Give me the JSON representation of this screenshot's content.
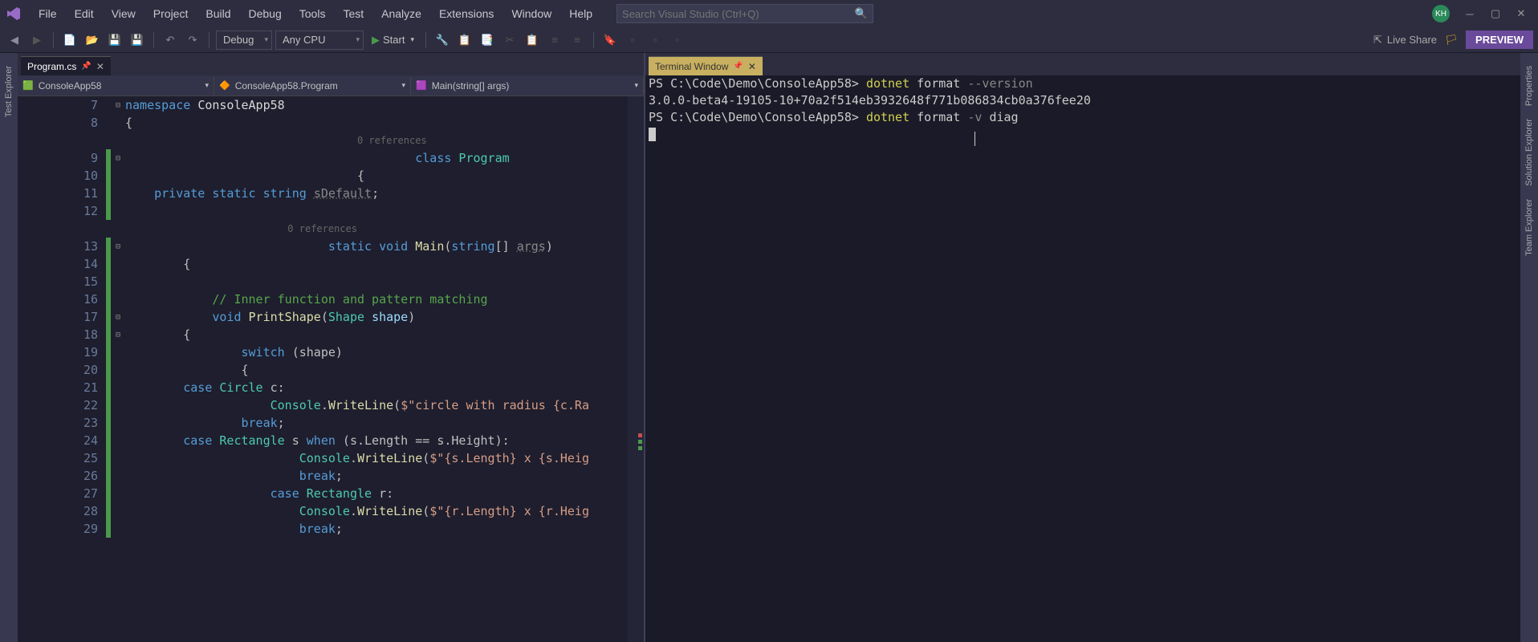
{
  "menu": [
    "File",
    "Edit",
    "View",
    "Project",
    "Build",
    "Debug",
    "Tools",
    "Test",
    "Analyze",
    "Extensions",
    "Window",
    "Help"
  ],
  "search": {
    "placeholder": "Search Visual Studio (Ctrl+Q)"
  },
  "avatar": "KH",
  "toolbar": {
    "config": "Debug",
    "platform": "Any CPU",
    "start": "Start",
    "liveShare": "Live Share",
    "preview": "PREVIEW"
  },
  "leftRail": [
    "Test Explorer"
  ],
  "rightRail": [
    "Properties",
    "Solution Explorer",
    "Team Explorer"
  ],
  "editorTab": {
    "name": "Program.cs"
  },
  "nav": {
    "project": "ConsoleApp58",
    "class": "ConsoleApp58.Program",
    "member": "Main(string[] args)"
  },
  "code": {
    "lines": [
      {
        "n": 7,
        "fold": "-",
        "html": "<span class='kw'>namespace</span> <span class='ident'>ConsoleApp58</span>"
      },
      {
        "n": 8,
        "html": "{"
      },
      {
        "hint": "                                        0 references"
      },
      {
        "n": 9,
        "fold": "-",
        "cb": "green",
        "html": "                                        <span class='kw'>class</span> <span class='type'>Program</span>"
      },
      {
        "n": 10,
        "cb": "green",
        "html": "                                {"
      },
      {
        "n": 11,
        "cb": "green",
        "html": "    <span class='kw'>private</span> <span class='kw'>static</span> <span class='kw'>string</span> <span class='dim'>sDefault</span>;"
      },
      {
        "n": 12,
        "cb": "green",
        "html": ""
      },
      {
        "hint": "                            0 references"
      },
      {
        "n": 13,
        "fold": "-",
        "cb": "green",
        "html": "                            <span class='kw'>static</span> <span class='kw'>void</span> <span class='fn'>Main</span>(<span class='kw'>string</span>[] <span class='param dim'>args</span>)"
      },
      {
        "n": 14,
        "cb": "green",
        "html": "        {"
      },
      {
        "n": 15,
        "cb": "green",
        "html": ""
      },
      {
        "n": 16,
        "cb": "green",
        "html": "            <span class='com'>// Inner function and pattern matching</span>"
      },
      {
        "n": 17,
        "fold": "-",
        "cb": "green",
        "html": "            <span class='kw'>void</span> <span class='fn'>PrintShape</span>(<span class='type'>Shape</span> <span class='param'>shape</span>)"
      },
      {
        "n": 18,
        "fold": "-",
        "cb": "green",
        "html": "        {"
      },
      {
        "n": 19,
        "cb": "green",
        "html": "                <span class='kw'>switch</span> (shape)"
      },
      {
        "n": 20,
        "cb": "green",
        "html": "                {"
      },
      {
        "n": 21,
        "cb": "green",
        "html": "        <span class='kw'>case</span> <span class='type'>Circle</span> c:"
      },
      {
        "n": 22,
        "cb": "green",
        "html": "                    <span class='type'>Console</span>.<span class='fn'>WriteLine</span>(<span class='str'>$\"circle with radius {c.Ra</span>"
      },
      {
        "n": 23,
        "cb": "green",
        "html": "                <span class='kw'>break</span>;"
      },
      {
        "n": 24,
        "cb": "green",
        "html": "        <span class='kw'>case</span> <span class='type'>Rectangle</span> s <span class='kw'>when</span> (s.Length == s.Height):"
      },
      {
        "n": 25,
        "cb": "green",
        "html": "                        <span class='type'>Console</span>.<span class='fn'>WriteLine</span>(<span class='str'>$\"{s.Length} x {s.Heig</span>"
      },
      {
        "n": 26,
        "cb": "green",
        "html": "                        <span class='kw'>break</span>;"
      },
      {
        "n": 27,
        "cb": "green",
        "html": "                    <span class='kw'>case</span> <span class='type'>Rectangle</span> r:"
      },
      {
        "n": 28,
        "cb": "green",
        "html": "                        <span class='type'>Console</span>.<span class='fn'>WriteLine</span>(<span class='str'>$\"{r.Length} x {r.Heig</span>"
      },
      {
        "n": 29,
        "cb": "green",
        "html": "                        <span class='kw'>break</span>;"
      }
    ]
  },
  "terminalTab": {
    "name": "Terminal Window"
  },
  "terminal": {
    "lines": [
      {
        "html": "PS C:\\Code\\Demo\\ConsoleApp58> <span class='tc-cmd'>dotnet</span> format <span class='tc-flag'>--version</span>"
      },
      {
        "html": "3.0.0-beta4-19105-10+70a2f514eb3932648f771b086834cb0a376fee20"
      },
      {
        "html": "PS C:\\Code\\Demo\\ConsoleApp58> <span class='tc-cmd'>dotnet</span> format <span class='tc-flag'>-v</span> diag"
      }
    ],
    "caretTop": 70,
    "caretLeft": 410
  }
}
